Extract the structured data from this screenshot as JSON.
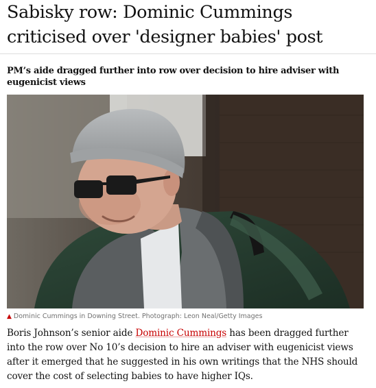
{
  "article": {
    "headline": "Sabisky row: Dominic Cummings criticised over 'designer babies' post",
    "standfirst": "PM’s aide dragged further into row over decision to hire adviser with eugenicist views",
    "image": {
      "caption_icon": "▲",
      "caption": "Dominic Cummings in Downing Street. Photograph: Leon Neal/Getty Images"
    },
    "body": {
      "before_link": "Boris Johnson’s senior aide ",
      "link_text": "Dominic Cummings",
      "after_link": " has been dragged further into the row over No 10’s decision to hire an adviser with eugenicist views after it emerged that he suggested in his own writings that the NHS should cover the cost of selecting babies to have higher IQs."
    }
  },
  "colors": {
    "accent": "#c70000",
    "text": "#121212",
    "caption": "#707070"
  }
}
